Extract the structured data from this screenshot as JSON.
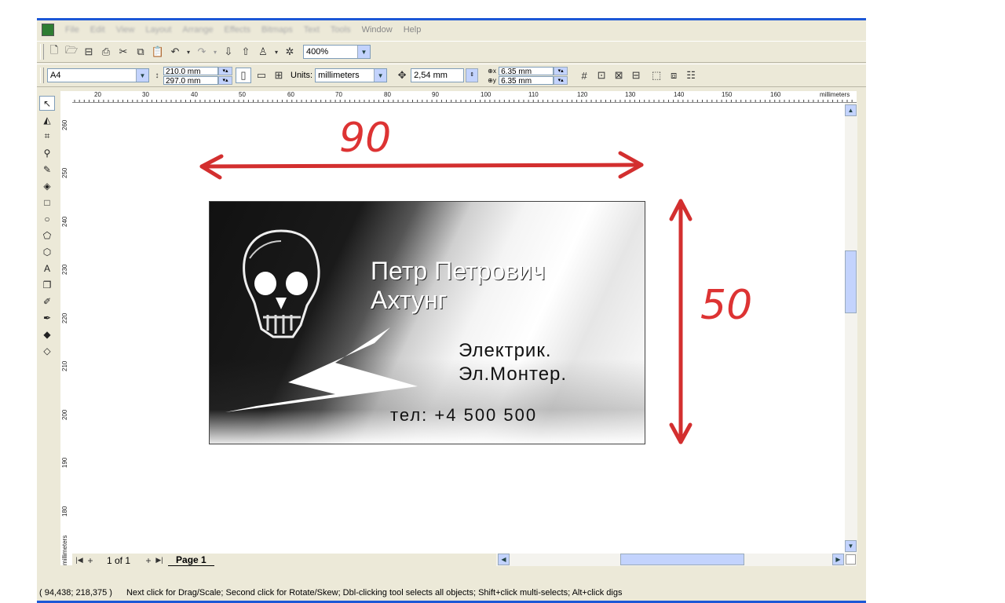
{
  "menubar": {
    "items": [
      "File",
      "Edit",
      "View",
      "Layout",
      "Arrange",
      "Effects",
      "Bitmaps",
      "Text",
      "Tools",
      "Window",
      "Help"
    ]
  },
  "toolbar": {
    "zoom": "400%"
  },
  "propertybar": {
    "page_size": "A4",
    "width": "210.0 mm",
    "height": "297.0 mm",
    "units_label": "Units:",
    "units_value": "millimeters",
    "nudge": "2,54 mm",
    "dup_x": "6.35 mm",
    "dup_y": "6.35 mm"
  },
  "ruler": {
    "h_ticks": [
      "20",
      "30",
      "40",
      "50",
      "60",
      "70",
      "80",
      "90",
      "100",
      "110",
      "120",
      "130",
      "140",
      "150",
      "160"
    ],
    "h_unit": "millimeters",
    "v_ticks": [
      "260",
      "250",
      "240",
      "230",
      "220",
      "210",
      "200",
      "190",
      "180"
    ],
    "v_unit": "millimeters"
  },
  "card": {
    "name_line1": "Петр Петрович",
    "name_line2": "Ахтунг",
    "job_line1": "Электрик.",
    "job_line2": "Эл.Монтер.",
    "phone": "тел: +4 500 500"
  },
  "annotations": {
    "width_label": "90",
    "height_label": "50",
    "arrow_color": "#d32f2f"
  },
  "pagenav": {
    "counter": "1 of 1",
    "page_tab": "Page 1"
  },
  "status": {
    "coords": "( 94,438; 218,375 )",
    "message": "Next click for Drag/Scale; Second click for Rotate/Skew; Dbl-clicking tool selects all objects; Shift+click multi-selects; Alt+click digs"
  }
}
